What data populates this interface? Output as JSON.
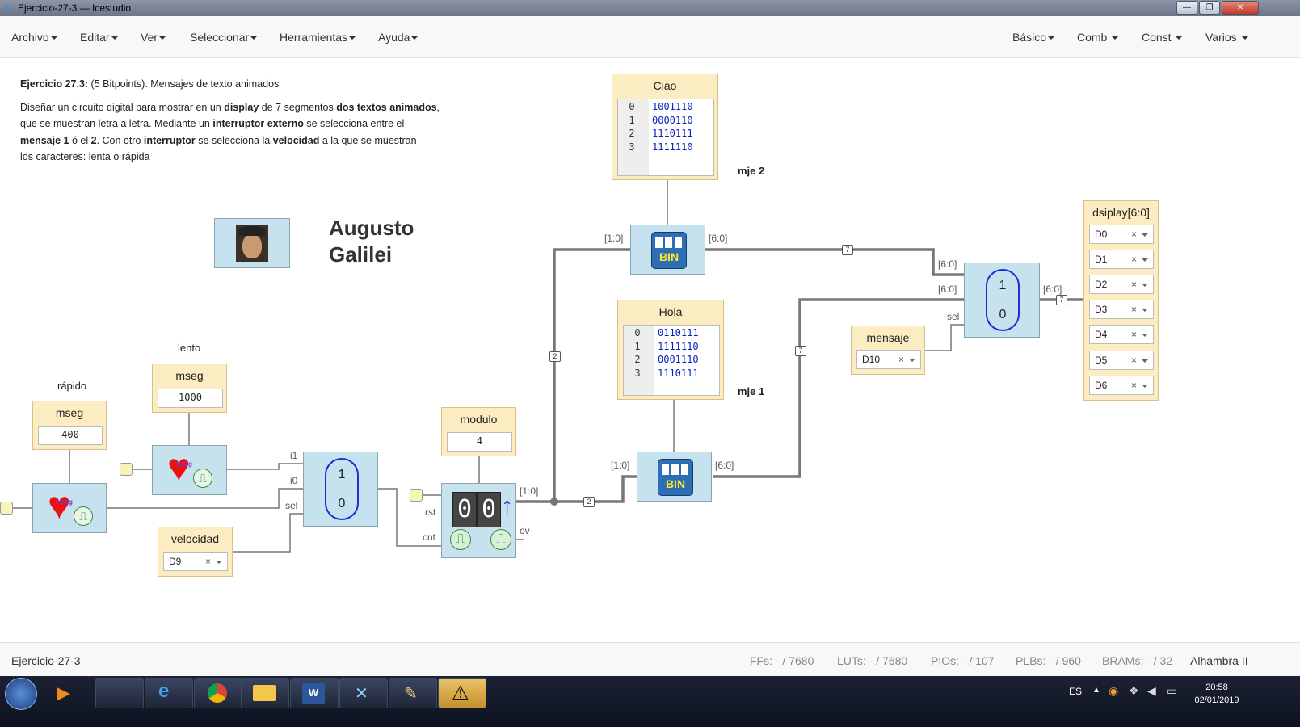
{
  "window": {
    "title": "Ejercicio-27-3 — Icestudio",
    "controls": [
      "—",
      "❐",
      "✕"
    ]
  },
  "menu_left": [
    "Archivo",
    "Editar",
    "Ver",
    "Seleccionar",
    "Herramientas",
    "Ayuda"
  ],
  "menu_right": [
    "Básico",
    "Comb",
    "Const",
    "Varios"
  ],
  "description": {
    "line1_bold": "Ejercicio 27.3:",
    "line1_rest": " (5 Bitpoints). Mensajes de texto animados",
    "p1": "Diseñar un circuito digital para mostrar en un ",
    "p1_b1": "display",
    "p2": " de 7 segmentos ",
    "p2_b": "dos textos animados",
    "p3": ",",
    "p4": "que se muestran letra a letra. Mediante un ",
    "p4_b": "interruptor externo",
    "p5": " se selecciona entre el",
    "p6_b": "mensaje 1",
    "p7": " ó el ",
    "p7_b": "2",
    "p8": ". Con otro ",
    "p8_b": "interruptor",
    "p9": " se selecciona la ",
    "p9_b": "velocidad",
    "p10": " a la que se muestran",
    "p11": "los caracteres: lenta o rápida"
  },
  "author": {
    "line1": "Augusto",
    "line2": "Galilei"
  },
  "blocks": {
    "ciao": {
      "title": "Ciao",
      "rows": [
        [
          "0",
          "1001110"
        ],
        [
          "1",
          "0000110"
        ],
        [
          "2",
          "1110111"
        ],
        [
          "3",
          "1111110"
        ]
      ],
      "note": "mje 2"
    },
    "hola": {
      "title": "Hola",
      "rows": [
        [
          "0",
          "0110111"
        ],
        [
          "1",
          "1111110"
        ],
        [
          "2",
          "0001110"
        ],
        [
          "3",
          "1110111"
        ]
      ],
      "note": "mje 1"
    },
    "display": {
      "title": "dsiplay[6:0]",
      "pins": [
        "D0",
        "D1",
        "D2",
        "D3",
        "D4",
        "D5",
        "D6"
      ]
    },
    "mensaje": {
      "title": "mensaje",
      "pin": "D10"
    },
    "velocidad": {
      "title": "velocidad",
      "pin": "D9"
    },
    "modulo": {
      "title": "modulo",
      "value": "4"
    },
    "mseg_rapido": {
      "caption": "rápido",
      "title": "mseg",
      "value": "400"
    },
    "mseg_lento": {
      "caption": "lento",
      "title": "mseg",
      "value": "1000"
    },
    "bin_label": "BIN",
    "heart_label": "mseg",
    "counter_digits": "00"
  },
  "ports": {
    "p10": "[1:0]",
    "p60": "[6:0]",
    "sel": "sel",
    "i1": "i1",
    "i0": "i0",
    "rst": "rst",
    "cnt": "cnt",
    "ov": "ov",
    "m1": "1",
    "m0": "0"
  },
  "wire_tags": {
    "w2": "2",
    "w7": "7"
  },
  "footer": {
    "project": "Ejercicio-27-3",
    "stats": [
      "FFs:  - / 7680",
      "LUTs:  - / 7680",
      "PIOs:  - / 107",
      "PLBs:  - / 960",
      "BRAMs:  - / 32"
    ],
    "board": "Alhambra II"
  },
  "taskbar": {
    "lang": "ES",
    "time": "20:58",
    "date": "02/01/2019"
  }
}
